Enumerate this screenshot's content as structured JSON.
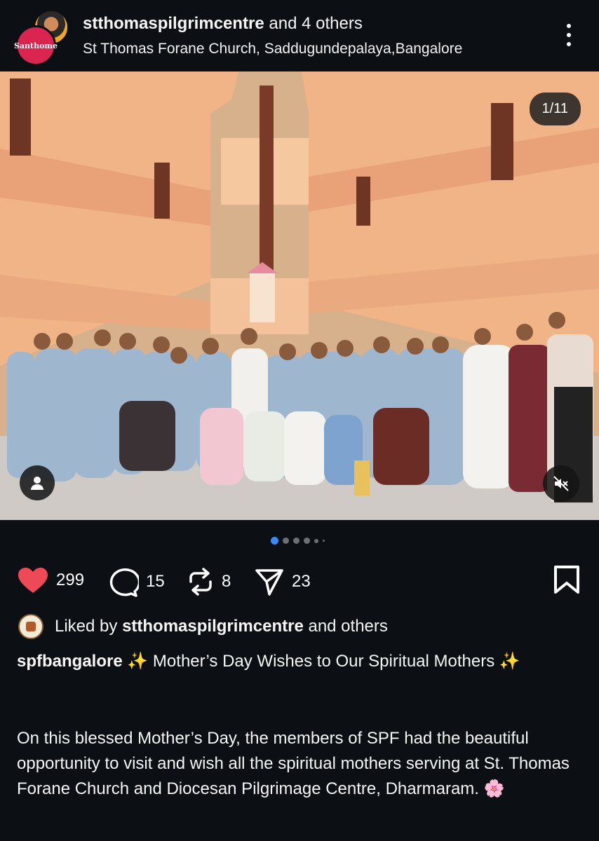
{
  "header": {
    "username": "stthomaspilgrimcentre",
    "collab_suffix": "and 4 others",
    "location": "St Thomas Forane Church, Saddugundepalaya,Bangalore",
    "avatar_badge": "Santhome"
  },
  "media": {
    "counter": "1/11",
    "icons": [
      "person-icon",
      "muted-speaker-icon"
    ],
    "description": "Group photo of nuns and visitors in a multi-storey courtyard"
  },
  "carousel": {
    "total_dots": 6,
    "active_index": 0
  },
  "actions": {
    "likes": "299",
    "comments": "15",
    "reposts": "8",
    "shares": "23",
    "like_color": "#ed4956"
  },
  "liked_by": {
    "prefix": "Liked by",
    "user": "stthomaspilgrimcentre",
    "suffix": "and others"
  },
  "caption": {
    "author": "spfbangalore",
    "spark1": "✨",
    "text": " Mother’s Day Wishes to Our Spiritual Mothers",
    "spark2": "✨",
    "body": "On this blessed Mother’s Day, the members of SPF had the beautiful opportunity to visit and wish all the spiritual mothers serving at St. Thomas Forane Church and Diocesan Pilgrimage Centre, Dharmaram.",
    "emoji_end": "🌸"
  }
}
